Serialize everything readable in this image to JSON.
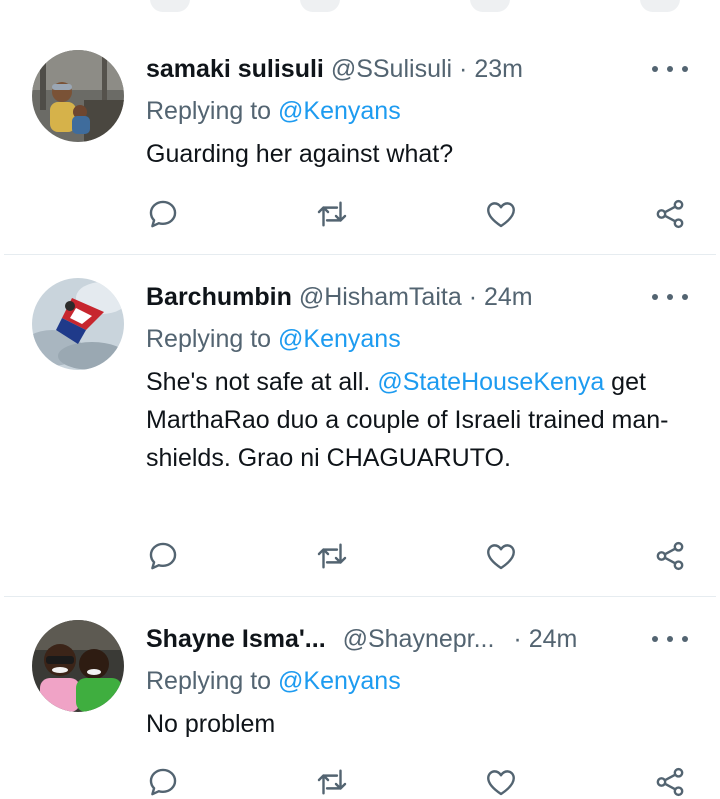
{
  "tweets": [
    {
      "name": "samaki sulisuli",
      "handle": "@SSulisuli",
      "sep": "·",
      "time": "23m",
      "replying_prefix": "Replying to",
      "replying_to": "@Kenyans",
      "text": "Guarding her against what?"
    },
    {
      "name": "Barchumbin",
      "handle": "@HishamTaita",
      "sep": "·",
      "time": "24m",
      "replying_prefix": "Replying to",
      "replying_to": "@Kenyans",
      "text_part1": "She's not safe at all.",
      "text_mention": "@StateHouseKenya",
      "text_part2": "get MarthaRao duo a couple of Israeli trained man-shields. Grao ni CHAGUARUTO."
    },
    {
      "name": "Shayne Isma'...",
      "handle": "@Shaynepr...",
      "sep": "·",
      "time": "24m",
      "replying_prefix": "Replying to",
      "replying_to": "@Kenyans",
      "text": "No problem"
    }
  ],
  "icons": {
    "reply": "reply-icon",
    "retweet": "retweet-icon",
    "like": "heart-icon",
    "share": "share-icon",
    "more": "more-icon"
  },
  "colors": {
    "link": "#1d9bf0",
    "secondary_text": "#536471",
    "primary_text": "#0f1419",
    "divider": "#e6ecf0"
  }
}
